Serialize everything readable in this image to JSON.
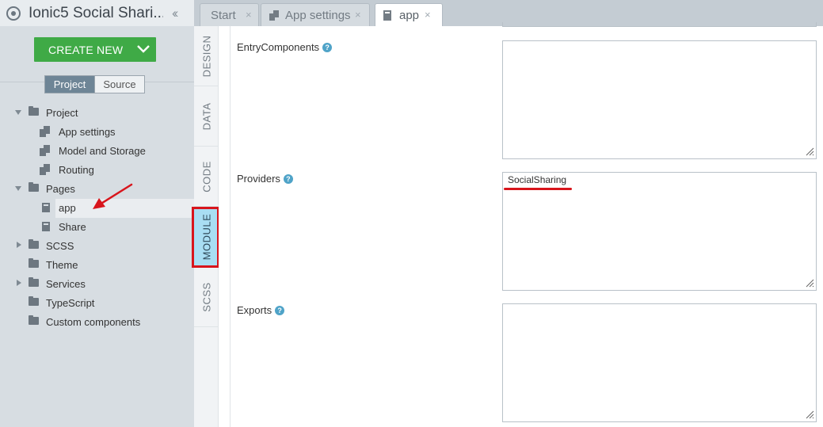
{
  "app": {
    "title": "Ionic5 Social Shari...",
    "collapse_icon": "double-chevron-left-icon"
  },
  "sidebar": {
    "create_button": {
      "label": "CREATE NEW",
      "color": "#3faa46"
    },
    "toggle": {
      "project": "Project",
      "source": "Source"
    },
    "tree": [
      {
        "label": "Project",
        "icon": "folder-icon",
        "expanded": true
      },
      {
        "label": "App settings",
        "icon": "multidoc-icon"
      },
      {
        "label": "Model and Storage",
        "icon": "multidoc-icon"
      },
      {
        "label": "Routing",
        "icon": "multidoc-icon"
      },
      {
        "label": "Pages",
        "icon": "folder-icon",
        "expanded": true
      },
      {
        "label": "app",
        "icon": "doc-icon",
        "selected": true
      },
      {
        "label": "Share",
        "icon": "doc-icon"
      },
      {
        "label": "SCSS",
        "icon": "folder-icon",
        "expanded": false
      },
      {
        "label": "Theme",
        "icon": "folder-icon"
      },
      {
        "label": "Services",
        "icon": "folder-icon",
        "expanded": false
      },
      {
        "label": "TypeScript",
        "icon": "folder-icon"
      },
      {
        "label": "Custom components",
        "icon": "folder-icon"
      }
    ]
  },
  "tabs": [
    {
      "label": "Start",
      "close": "×"
    },
    {
      "label": "App settings",
      "close": "×",
      "icon": "multidoc-icon"
    },
    {
      "label": "app",
      "close": "×",
      "icon": "doc-icon",
      "active": true
    }
  ],
  "vertical_tabs": [
    {
      "label": "DESIGN"
    },
    {
      "label": "DATA"
    },
    {
      "label": "CODE"
    },
    {
      "label": "MODULE",
      "active": true
    },
    {
      "label": "SCSS"
    }
  ],
  "fields": {
    "entry_components": {
      "label": "EntryComponents",
      "value": ""
    },
    "providers": {
      "label": "Providers",
      "value": "SocialSharing"
    },
    "exports": {
      "label": "Exports",
      "value": ""
    },
    "help": "?"
  },
  "colors": {
    "annotation_red": "#d8151c",
    "active_vtab": "#a9def3",
    "help_icon": "#4fa3c8"
  }
}
